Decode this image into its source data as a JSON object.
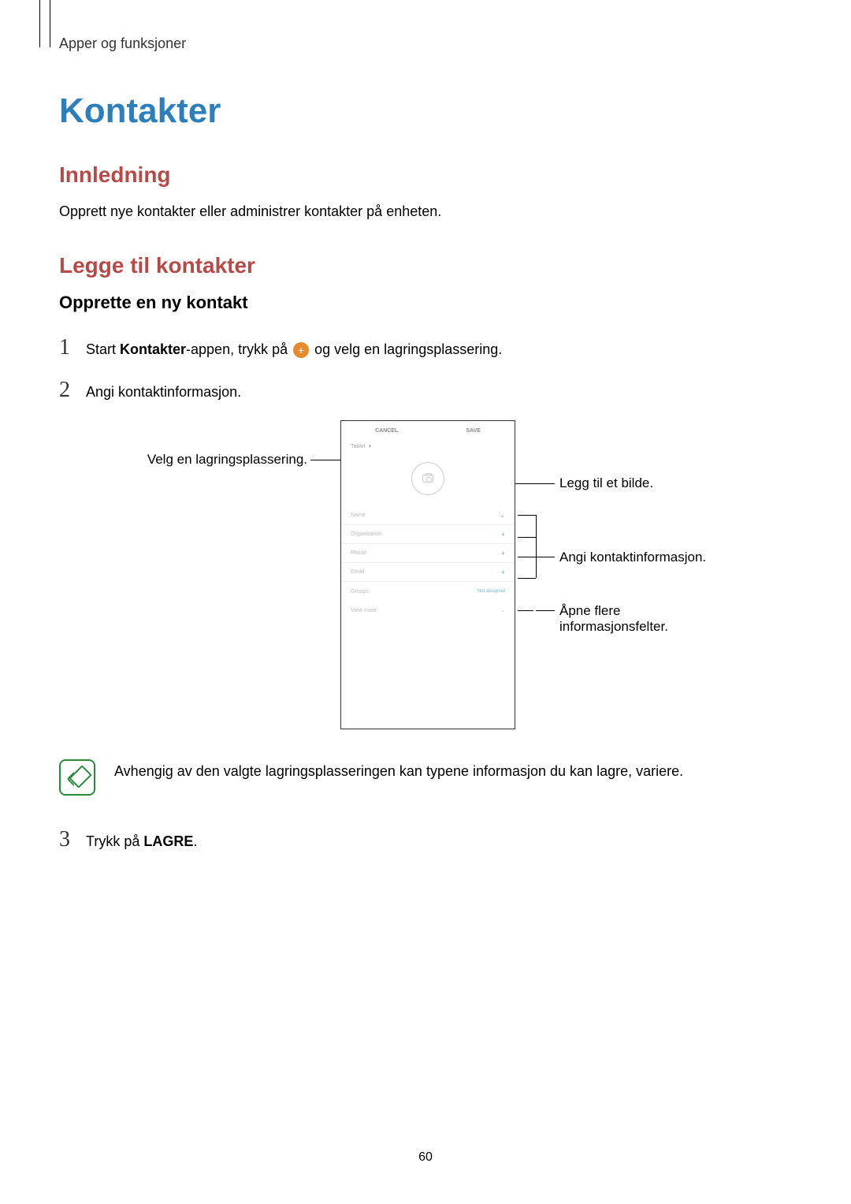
{
  "breadcrumb": "Apper og funksjoner",
  "title": "Kontakter",
  "section_intro_heading": "Innledning",
  "section_intro_text": "Opprett nye kontakter eller administrer kontakter på enheten.",
  "section_add_heading": "Legge til kontakter",
  "subsection_heading": "Opprette en ny kontakt",
  "step1": {
    "num": "1",
    "pre": "Start ",
    "bold1": "Kontakter",
    "mid": "-appen, trykk på ",
    "post": " og velg en lagringsplassering."
  },
  "step2": {
    "num": "2",
    "text": "Angi kontaktinformasjon."
  },
  "step3": {
    "num": "3",
    "pre": "Trykk på ",
    "bold": "LAGRE",
    "post": "."
  },
  "callouts": {
    "storage": "Velg en lagringsplassering.",
    "image": "Legg til et bilde.",
    "info": "Angi kontaktinformasjon.",
    "more": "Åpne flere informasjonsfelter."
  },
  "phone": {
    "cancel": "CANCEL",
    "save": "SAVE",
    "storage": "Tablet",
    "fields": {
      "name": "Name",
      "organisation": "Organisation",
      "phone": "Phone",
      "email": "Email",
      "groups": "Groups",
      "groups_action": "Not assigned",
      "viewmore": "View more"
    }
  },
  "note_text": "Avhengig av den valgte lagringsplasseringen kan typene informasjon du kan lagre, variere.",
  "page_number": "60"
}
